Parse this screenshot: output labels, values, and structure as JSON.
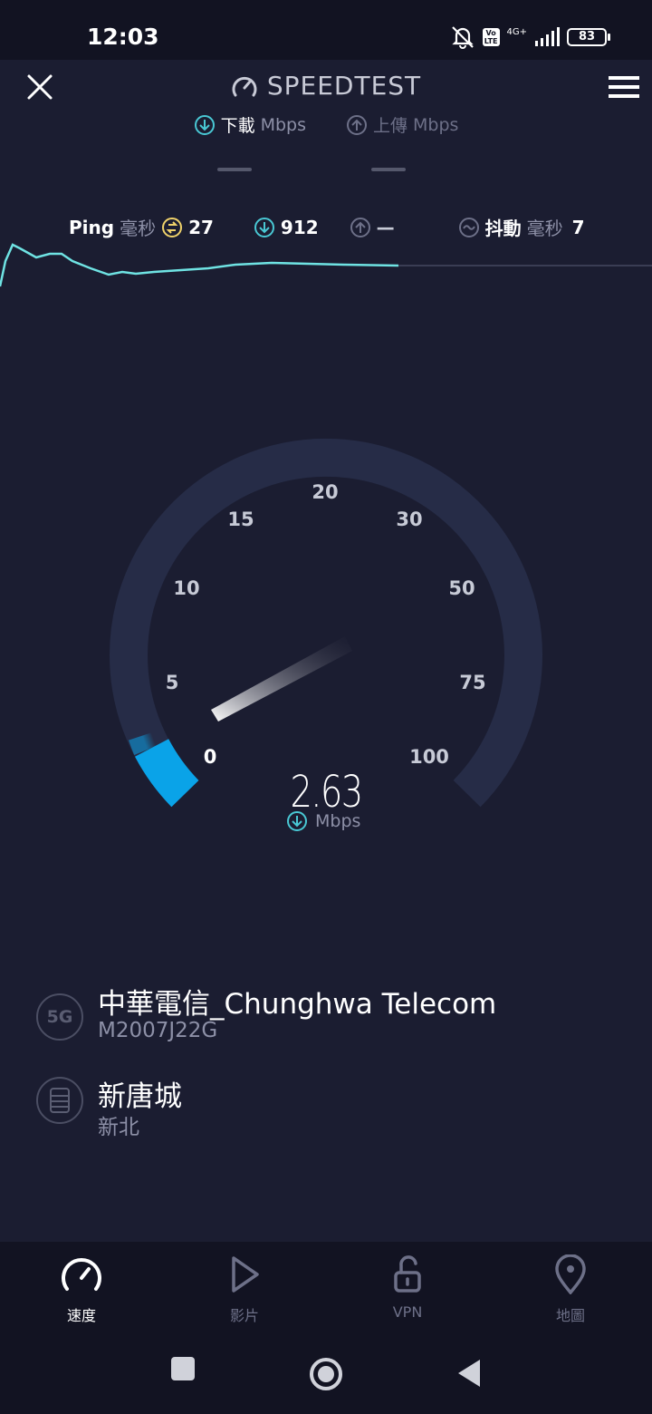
{
  "status_bar": {
    "time": "12:03",
    "volte_label": "Vo\nLTE",
    "network_label": "4G+",
    "battery": "83",
    "icons": [
      "mute-icon",
      "volte-icon",
      "signal-icon",
      "battery-icon"
    ]
  },
  "header": {
    "title": "SPEEDTEST",
    "close_icon": "close-icon",
    "menu_icon": "menu-icon",
    "speedometer_icon": "speedometer-icon"
  },
  "tabs": [
    {
      "label": "下載",
      "unit": "Mbps",
      "icon": "download-icon",
      "active": true
    },
    {
      "label": "上傳",
      "unit": "Mbps",
      "icon": "upload-icon",
      "active": false
    }
  ],
  "metrics": {
    "ping_label": "Ping",
    "ping_unit": "毫秒",
    "ping_value": "27",
    "download_value": "912",
    "upload_value": "—",
    "jitter_label": "抖動",
    "jitter_unit": "毫秒",
    "jitter_value": "7"
  },
  "gauge": {
    "scale_labels": [
      "0",
      "5",
      "10",
      "15",
      "20",
      "30",
      "50",
      "75",
      "100"
    ],
    "current_speed": "2.63",
    "unit": "Mbps",
    "accent_color": "#0aa3e8",
    "track_color": "#262c47"
  },
  "connection": {
    "network_badge": "5G",
    "isp": "中華電信_Chunghwa Telecom",
    "device": "M2007J22G",
    "server_name": "新唐城",
    "server_location": "新北"
  },
  "bottom_nav": [
    {
      "label": "速度",
      "icon": "speedometer-icon",
      "active": true
    },
    {
      "label": "影片",
      "icon": "play-icon",
      "active": false
    },
    {
      "label": "VPN",
      "icon": "unlock-icon",
      "active": false
    },
    {
      "label": "地圖",
      "icon": "map-pin-icon",
      "active": false
    }
  ],
  "colors": {
    "background": "#1b1d31",
    "graph_line": "#6fe3e3",
    "accent": "#0aa3e8"
  }
}
